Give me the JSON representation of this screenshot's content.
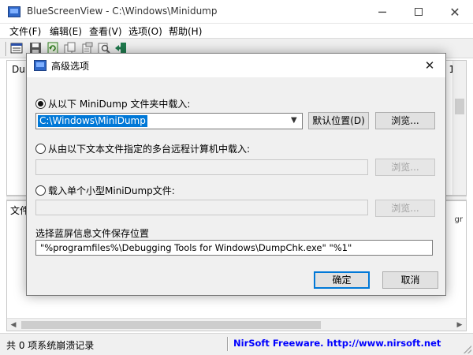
{
  "window": {
    "title": "BlueScreenView  -  C:\\Windows\\Minidump",
    "minimize": "─",
    "close": "✕"
  },
  "menu": [
    "文件(F)",
    "编辑(E)",
    "查看(V)",
    "选项(O)",
    "帮助(H)"
  ],
  "toolbar": {
    "icons": [
      "properties-icon",
      "save-icon",
      "refresh-icon",
      "copy-icon",
      "html-report-icon",
      "find-icon",
      "exit-icon"
    ]
  },
  "top_pane": {
    "label": "Dum",
    "right_edge": "1"
  },
  "bottom_pane": {
    "label": "文件",
    "right_edge": "gr"
  },
  "status": {
    "left": "共 0 项系统崩溃记录",
    "right": "NirSoft Freeware.  http://www.nirsoft.net"
  },
  "dialog": {
    "title": "高级选项",
    "close": "✕",
    "option1": {
      "label": "从以下 MiniDump 文件夹中载入:",
      "checked": true,
      "value": "C:\\Windows\\MiniDump",
      "default_button": "默认位置(D)",
      "browse_button": "浏览..."
    },
    "option2": {
      "label": "从由以下文本文件指定的多台远程计算机中载入:",
      "checked": false,
      "browse_button": "浏览..."
    },
    "option3": {
      "label": "载入单个小型MiniDump文件:",
      "checked": false,
      "browse_button": "浏览..."
    },
    "save_location": {
      "label": "选择蓝屏信息文件保存位置",
      "value": "\"%programfiles%\\Debugging Tools for Windows\\DumpChk.exe\" \"%1\""
    },
    "ok_button": "确定",
    "cancel_button": "取消"
  },
  "colors": {
    "selection": "#0078d7",
    "link": "#0000ff",
    "dialog_bg": "#f0f0f0"
  }
}
